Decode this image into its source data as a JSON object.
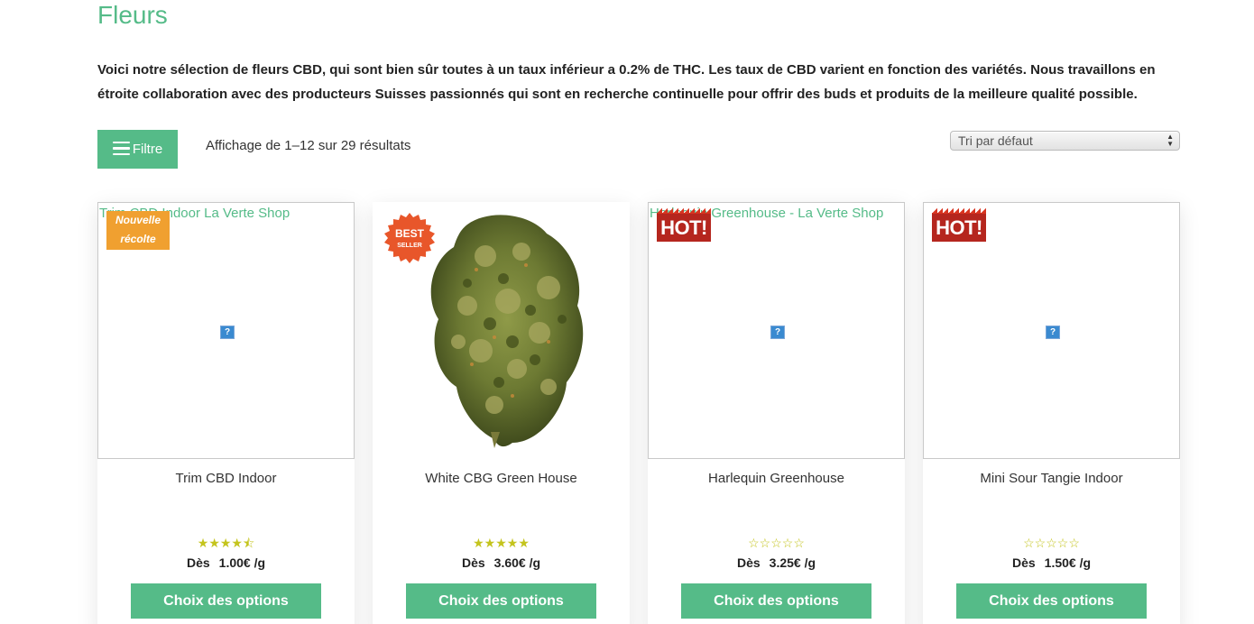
{
  "page": {
    "title": "Fleurs",
    "intro": "Voici notre sélection de fleurs CBD, qui sont bien sûr toutes à un taux inférieur a 0.2% de THC. Les taux de CBD varient en fonction des variétés. Nous travaillons en étroite collaboration avec des producteurs Suisses passionnés qui sont en recherche continuelle pour offrir des buds et produits de la meilleure qualité possible."
  },
  "toolbar": {
    "filter_label": "Filtre",
    "result_count": "Affichage de 1–12 sur 29 résultats",
    "sort_selected": "Tri par défaut"
  },
  "colors": {
    "accent": "#55bb88",
    "badge_new": "#f0a030",
    "badge_hot": "#b5261e",
    "badge_best": "#e8562a",
    "star": "#c4c41d"
  },
  "products": [
    {
      "name": "Trim CBD Indoor",
      "image_alt": "Trim CBD Indoor La Verte Shop",
      "badge": "Nouvelle récolte",
      "badge_line1": "Nouvelle",
      "badge_line2": "récolte",
      "rating": 4.5,
      "stars": "★★★★⯪",
      "price_prefix": "Dès",
      "price": "1.00€ /g",
      "button": "Choix des options"
    },
    {
      "name": "White CBG Green House",
      "image_alt": "",
      "badge": "BEST SELLER",
      "badge_line1": "BEST",
      "badge_line2": "SELLER",
      "rating": 5,
      "stars": "★★★★★",
      "price_prefix": "Dès",
      "price": "3.60€ /g",
      "button": "Choix des options"
    },
    {
      "name": "Harlequin Greenhouse",
      "image_alt": "Harlequin Greenhouse - La Verte Shop",
      "badge": "HOT!",
      "rating": 0,
      "stars": "☆☆☆☆☆",
      "price_prefix": "Dès",
      "price": "3.25€ /g",
      "button": "Choix des options"
    },
    {
      "name": "Mini Sour Tangie Indoor",
      "image_alt": "",
      "badge": "HOT!",
      "rating": 0,
      "stars": "☆☆☆☆☆",
      "price_prefix": "Dès",
      "price": "1.50€ /g",
      "button": "Choix des options"
    }
  ]
}
